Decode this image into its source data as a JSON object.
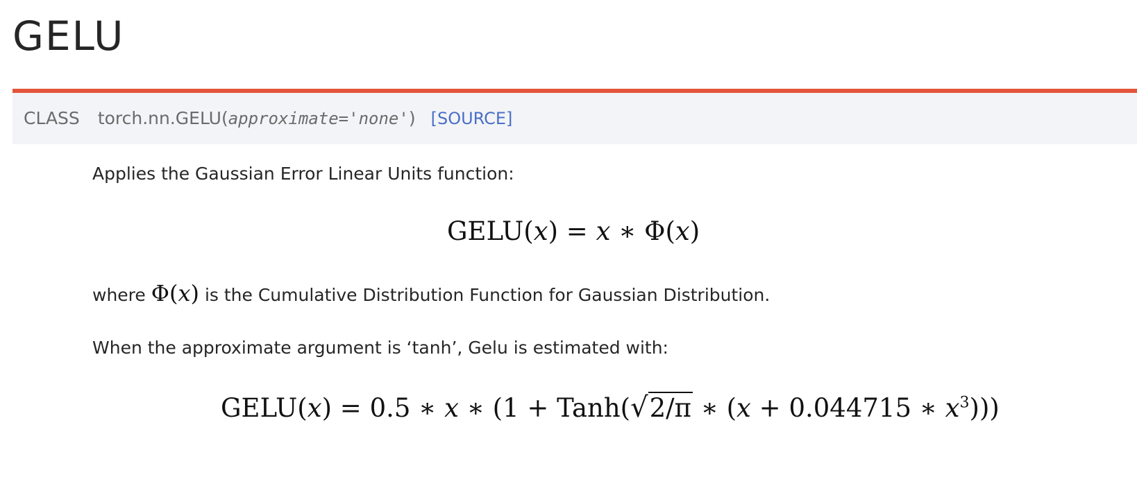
{
  "page_title": "GELU",
  "signature": {
    "class_label": "CLASS",
    "name": "torch.nn.GELU",
    "open_paren": "(",
    "param": "approximate='none'",
    "close_paren": ")",
    "source_link": "[SOURCE]"
  },
  "paragraphs": {
    "intro": "Applies the Gaussian Error Linear Units function:",
    "where_prefix": "where",
    "where_suffix": "is the Cumulative Distribution Function for Gaussian Distribution.",
    "approx": "When the approximate argument is ‘tanh’, Gelu is estimated with:"
  },
  "equations": {
    "eq1_lhs": "GELU(",
    "eq1_x": "x",
    "eq1_mid": ") = ",
    "eq1_x2": "x",
    "eq1_star": " ∗ Φ(",
    "eq1_x3": "x",
    "eq1_end": ")",
    "inline_phi": "Φ(",
    "inline_x": "x",
    "inline_end": ")",
    "eq2_lhs": "GELU(",
    "eq2_x": "x",
    "eq2_a": ") = 0.5 ∗ ",
    "eq2_x2": "x",
    "eq2_b": " ∗ (1 + Tanh(",
    "eq2_sqrt_sign": "√",
    "eq2_sqrt_body": "2/π",
    "eq2_c": " ∗ (",
    "eq2_x3": "x",
    "eq2_d": " + 0.044715 ∗ ",
    "eq2_x4": "x",
    "eq2_exp": "3",
    "eq2_end": ")))"
  }
}
